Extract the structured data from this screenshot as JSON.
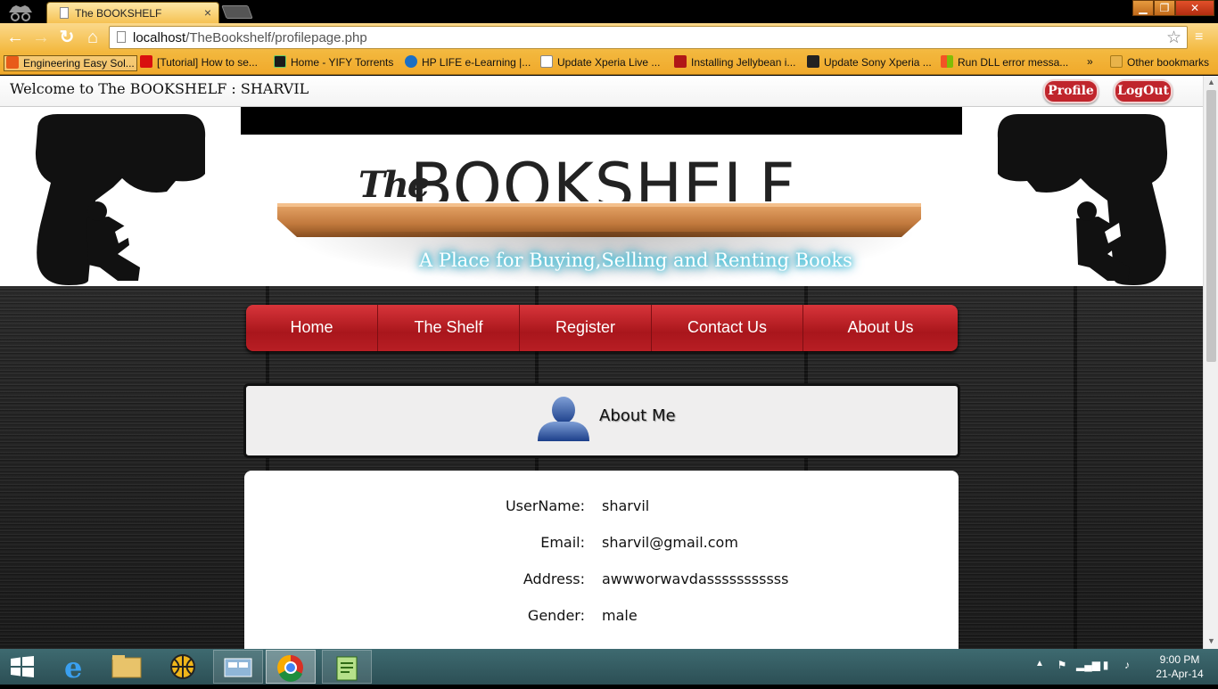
{
  "browser": {
    "tab_title": "The BOOKSHELF",
    "tab_close": "×",
    "url_host": "localhost",
    "url_path": "/TheBookshelf/profilepage.php",
    "window_buttons": {
      "minimize": "▁",
      "maximize": "❐",
      "close": "✕"
    },
    "bookmarks": [
      {
        "label": "Engineering Easy Sol...",
        "icon_color": "#e85b19"
      },
      {
        "label": "[Tutorial] How to se...",
        "icon_color": "#d90f0f"
      },
      {
        "label": "Home - YIFY Torrents",
        "icon_color": "#1b1b1b"
      },
      {
        "label": "HP LIFE e-Learning |...",
        "icon_color": "#1b6fc4"
      },
      {
        "label": "Update Xperia Live ...",
        "icon_color": "#ffffff"
      },
      {
        "label": "Installing Jellybean i...",
        "icon_color": "#b01717"
      },
      {
        "label": "Update Sony Xperia ...",
        "icon_color": "#222222"
      },
      {
        "label": "Run DLL error messa...",
        "icon_color": "#4a90e2"
      }
    ],
    "bookmarks_overflow": "»",
    "other_bookmarks": "Other bookmarks"
  },
  "page": {
    "welcome": "Welcome to The BOOKSHELF : SHARVIL",
    "profile_btn": "Profile",
    "logout_btn": "LogOut",
    "logo_the": "The",
    "logo_word": "BOOKSHELF",
    "tagline": "A Place for Buying,Selling and Renting Books",
    "nav": {
      "home": "Home",
      "shelf": "The Shelf",
      "register": "Register",
      "contact": "Contact Us",
      "about": "About Us"
    },
    "about_title": "About Me",
    "fields": [
      {
        "label": "UserName:",
        "value": "sharvil"
      },
      {
        "label": "Email:",
        "value": "sharvil@gmail.com"
      },
      {
        "label": "Address:",
        "value": "awwworwavdasssssssssss"
      },
      {
        "label": "Gender:",
        "value": "male"
      }
    ]
  },
  "colors": {
    "accent_red": "#b81e24",
    "chrome_orange": "#f3b83e",
    "tagline_glow": "#2fd2e8"
  },
  "taskbar": {
    "time": "9:00 PM",
    "date": "21-Apr-14"
  }
}
